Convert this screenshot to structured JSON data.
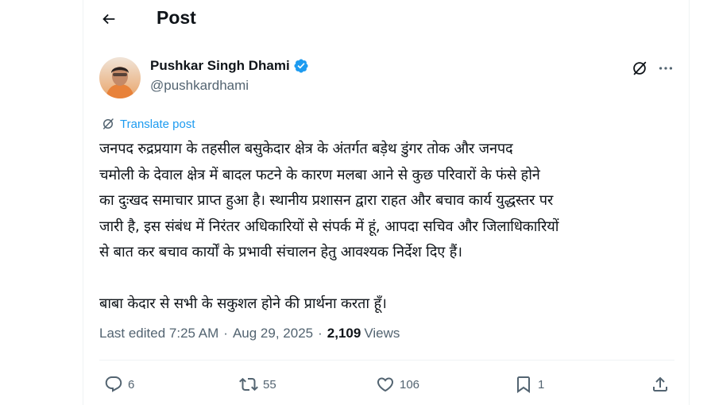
{
  "header": {
    "title": "Post"
  },
  "author": {
    "name": "Pushkar Singh Dhami",
    "handle": "@pushkardhami",
    "verified": true
  },
  "translate_label": "Translate post",
  "post": {
    "text": "जनपद रुद्रप्रयाग के तहसील बसुकेदार क्षेत्र के अंतर्गत बड़ेथ डुंगर तोक और जनपद\nचमोली के देवाल क्षेत्र में बादल फटने के कारण मलबा आने से कुछ परिवारों के फंसे होने\nका दुःखद समाचार प्राप्त हुआ है। स्थानीय प्रशासन द्वारा राहत और बचाव कार्य युद्धस्तर पर\nजारी है, इस संबंध में निरंतर अधिकारियों से संपर्क में हूं, आपदा सचिव और जिलाधिकारियों\nसे बात कर बचाव कार्यों के प्रभावी संचालन हेतु आवश्यक निर्देश दिए हैं।\n\nबाबा केदार से सभी के सकुशल होने की प्रार्थना करता हूँ।"
  },
  "meta": {
    "last_edited": "Last edited 7:25 AM",
    "sep1": "·",
    "date": "Aug 29, 2025",
    "sep2": "·",
    "views_count": "2,109",
    "views_label": "Views"
  },
  "actions": {
    "replies": "6",
    "reposts": "55",
    "likes": "106",
    "bookmarks": "1"
  },
  "colors": {
    "accent": "#1d9bf0",
    "secondary_text": "#536471",
    "verified": "#1d9bf0"
  },
  "icons": [
    "back-arrow-icon",
    "verified-badge-icon",
    "grok-icon",
    "more-icon",
    "translate-icon",
    "reply-icon",
    "repost-icon",
    "like-icon",
    "bookmark-icon",
    "share-icon"
  ]
}
